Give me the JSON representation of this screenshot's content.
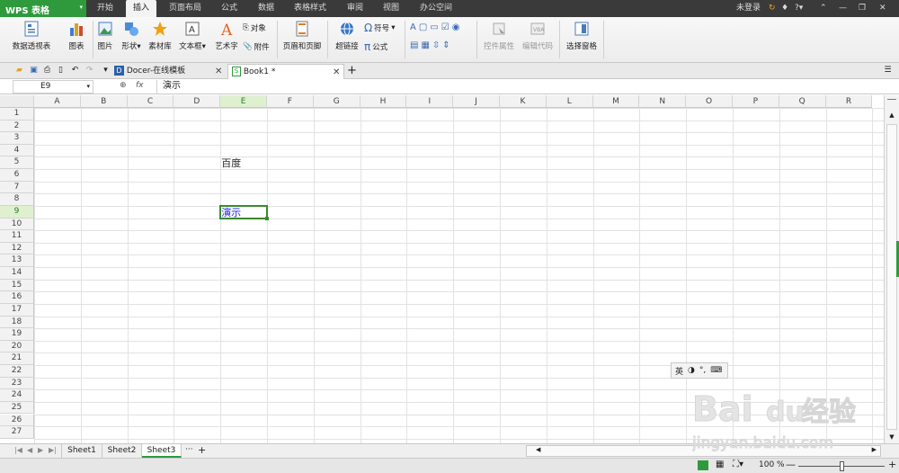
{
  "app": {
    "title": "WPS 表格"
  },
  "menubar": {
    "tabs": [
      {
        "label": "开始"
      },
      {
        "label": "插入"
      },
      {
        "label": "页面布局"
      },
      {
        "label": "公式"
      },
      {
        "label": "数据"
      },
      {
        "label": "表格样式"
      },
      {
        "label": "审阅"
      },
      {
        "label": "视图"
      },
      {
        "label": "办公空间"
      }
    ],
    "active_tab": "插入",
    "login": "未登录",
    "help": "?"
  },
  "ribbon": {
    "pivot": "数据透视表",
    "chart": "图表",
    "picture": "图片",
    "shapes": "形状",
    "material": "素材库",
    "textbox": "文本框",
    "wordart": "艺术字",
    "object": "对象",
    "attachment": "附件",
    "header_footer": "页眉和页脚",
    "hyperlink": "超链接",
    "symbol": "符号",
    "formula": "公式",
    "control_props": "控件属性",
    "edit_code": "编辑代码",
    "selection_pane": "选择窗格"
  },
  "doctabs": {
    "docer": "Docer-在线模板",
    "book": "Book1 *"
  },
  "formula_bar": {
    "name_box": "E9",
    "fx": "fx",
    "content": "演示"
  },
  "grid": {
    "columns": [
      "A",
      "B",
      "C",
      "D",
      "E",
      "F",
      "G",
      "H",
      "I",
      "J",
      "K",
      "L",
      "M",
      "N",
      "O",
      "P",
      "Q",
      "R"
    ],
    "rows": [
      "1",
      "2",
      "3",
      "4",
      "5",
      "6",
      "7",
      "8",
      "9",
      "10",
      "11",
      "12",
      "13",
      "14",
      "15",
      "16",
      "17",
      "18",
      "19",
      "20",
      "21",
      "22",
      "23",
      "24",
      "25",
      "26",
      "27"
    ],
    "selected_col": "E",
    "selected_row": "9",
    "cells": [
      {
        "ref": "E5",
        "value": "百度"
      },
      {
        "ref": "E9",
        "value": "演示",
        "color": "#1a1aff"
      }
    ]
  },
  "sheets": {
    "tabs": [
      "Sheet1",
      "Sheet2",
      "Sheet3"
    ],
    "active": "Sheet3",
    "more": "···",
    "add": "+"
  },
  "status": {
    "zoom": "100 %"
  },
  "ime": {
    "mode": "英"
  },
  "watermark": {
    "text1": "Bai",
    "text2": "du",
    "text3": "经验",
    "url": "jingyan.baidu.com"
  },
  "colors": {
    "accent": "#2f9a3c",
    "menubar": "#3a3a3a",
    "selection": "#3a8a2a",
    "blue_text": "#1a1aff"
  }
}
